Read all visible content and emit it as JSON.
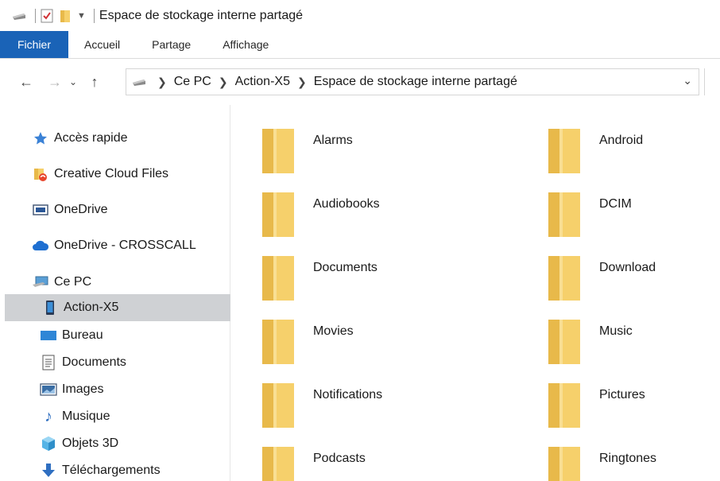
{
  "window": {
    "title": "Espace de stockage interne partagé"
  },
  "ribbon": {
    "tabs": [
      "Fichier",
      "Accueil",
      "Partage",
      "Affichage"
    ]
  },
  "address": {
    "crumbs": [
      "Ce PC",
      "Action-X5",
      "Espace de stockage interne partagé"
    ]
  },
  "nav": {
    "items": [
      "Accès rapide",
      "Creative Cloud Files",
      "OneDrive",
      "OneDrive - CROSSCALL",
      "Ce PC",
      "Action-X5",
      "Bureau",
      "Documents",
      "Images",
      "Musique",
      "Objets 3D",
      "Téléchargements"
    ],
    "selected": "Action-X5"
  },
  "folders": [
    "Alarms",
    "Android",
    "Audiobooks",
    "DCIM",
    "Documents",
    "Download",
    "Movies",
    "Music",
    "Notifications",
    "Pictures",
    "Podcasts",
    "Ringtones"
  ],
  "colors": {
    "accent": "#1a63b7",
    "folder": "#f6d06b",
    "folder_dark": "#e8b94a",
    "selected_bg": "#cfd1d4"
  }
}
